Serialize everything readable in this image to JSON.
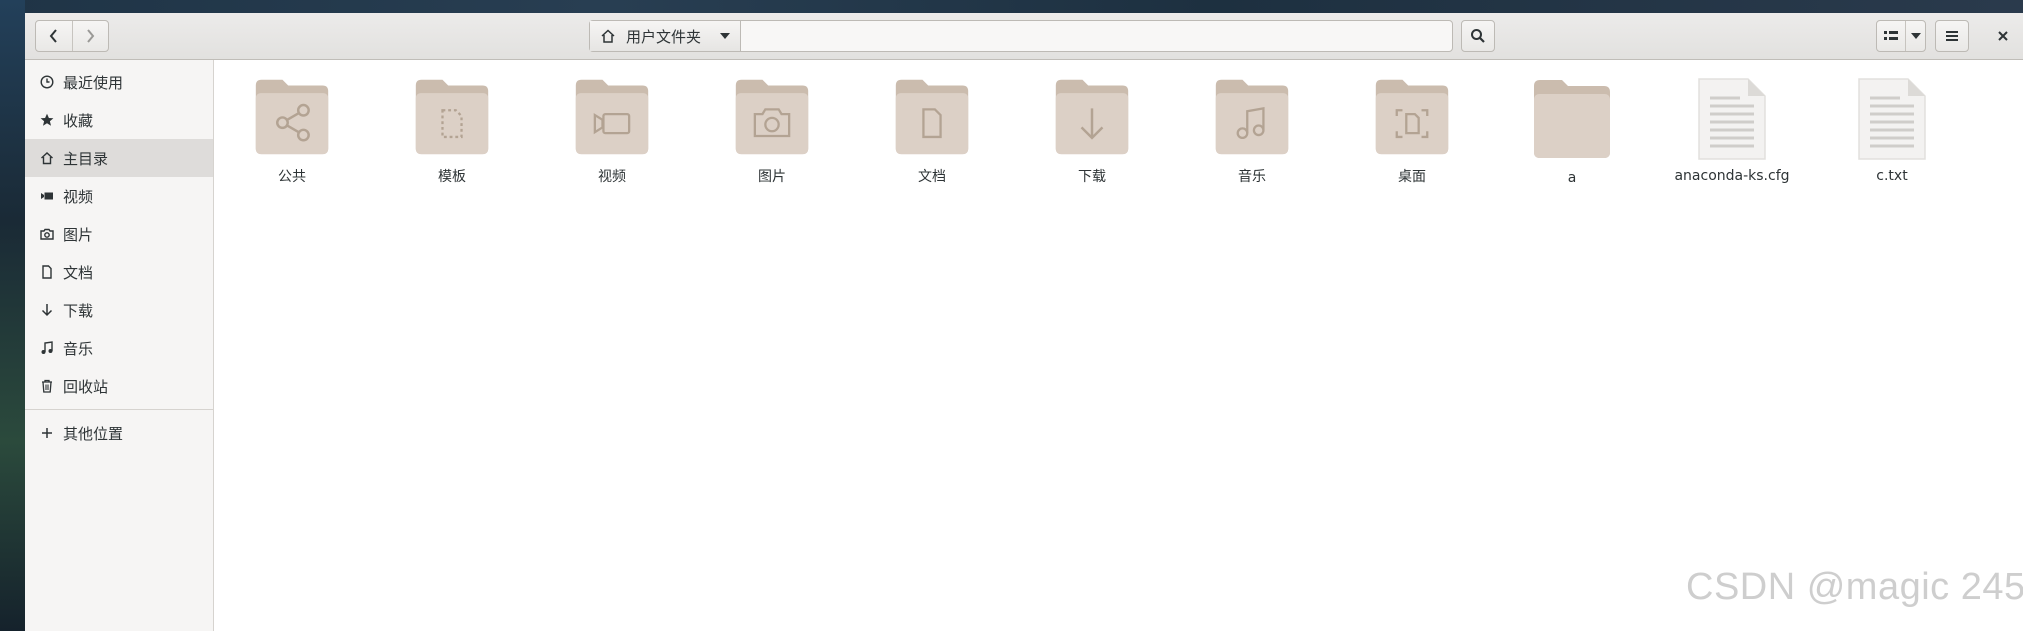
{
  "pathbar": {
    "location": "用户文件夹"
  },
  "sidebar": {
    "items": [
      {
        "label": "最近使用",
        "icon": "clock-icon"
      },
      {
        "label": "收藏",
        "icon": "star-icon"
      },
      {
        "label": "主目录",
        "icon": "home-icon",
        "active": true
      },
      {
        "label": "视频",
        "icon": "video-icon"
      },
      {
        "label": "图片",
        "icon": "camera-icon"
      },
      {
        "label": "文档",
        "icon": "document-icon"
      },
      {
        "label": "下载",
        "icon": "download-icon"
      },
      {
        "label": "音乐",
        "icon": "music-icon"
      },
      {
        "label": "回收站",
        "icon": "trash-icon"
      }
    ],
    "other": {
      "label": "其他位置",
      "icon": "plus-icon"
    }
  },
  "files": [
    {
      "name": "公共",
      "kind": "folder",
      "icon": "share-icon"
    },
    {
      "name": "模板",
      "kind": "folder",
      "icon": "template-icon"
    },
    {
      "name": "视频",
      "kind": "folder",
      "icon": "video-icon"
    },
    {
      "name": "图片",
      "kind": "folder",
      "icon": "camera-icon"
    },
    {
      "name": "文档",
      "kind": "folder",
      "icon": "document-icon"
    },
    {
      "name": "下载",
      "kind": "folder",
      "icon": "download-icon"
    },
    {
      "name": "音乐",
      "kind": "folder",
      "icon": "music-icon"
    },
    {
      "name": "桌面",
      "kind": "folder",
      "icon": "desktop-icon"
    },
    {
      "name": "a",
      "kind": "folder",
      "icon": ""
    },
    {
      "name": "anaconda-ks.cfg",
      "kind": "file",
      "icon": "text-file-icon"
    },
    {
      "name": "c.txt",
      "kind": "file",
      "icon": "text-file-icon"
    }
  ],
  "watermark": "CSDN @magic 245",
  "colors": {
    "folder": "#dcd0c6",
    "folder_tab": "#cbbcae",
    "folder_glyph": "#b3a393",
    "active_row": "#dedcda"
  }
}
